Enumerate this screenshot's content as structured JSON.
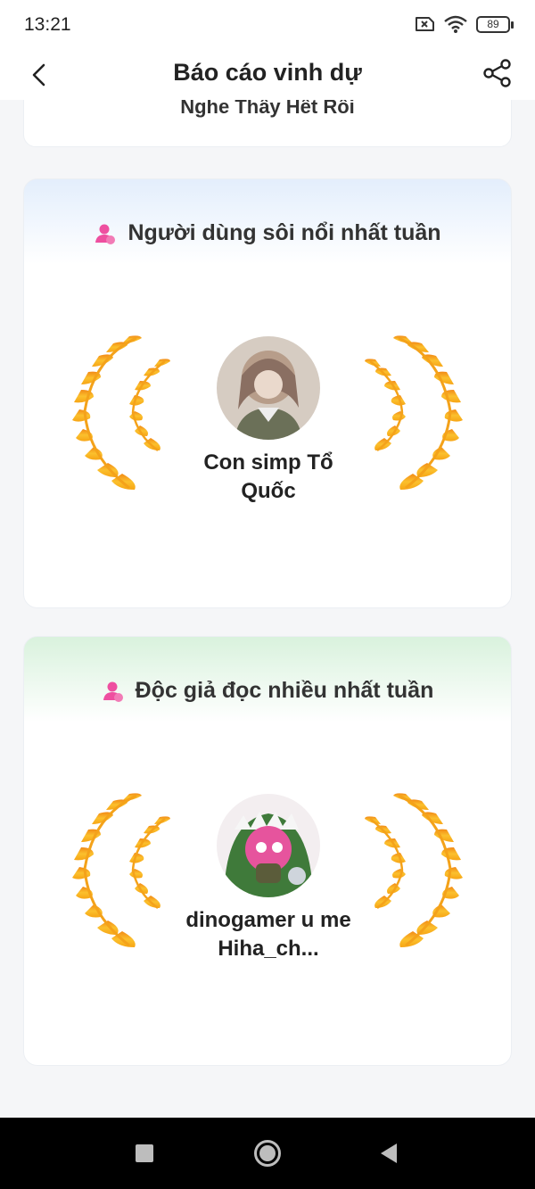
{
  "status": {
    "time": "13:21",
    "battery": "89"
  },
  "header": {
    "title": "Báo cáo vinh dự"
  },
  "previous_card": {
    "name": "Nghe Thấy Hết Rồi"
  },
  "cards": [
    {
      "title": "Người dùng sôi nổi nhất tuần",
      "winner": "Con simp Tổ Quốc",
      "theme": "#e3eefc"
    },
    {
      "title": "Độc giả đọc nhiều nhất tuần",
      "winner": "dinogamer u me Hiha_ch...",
      "theme": "#d9f2dd"
    }
  ],
  "colors": {
    "laurel_gold": "#f9b21a",
    "laurel_orange": "#f28a16",
    "user_icon": "#ee4fa0"
  }
}
